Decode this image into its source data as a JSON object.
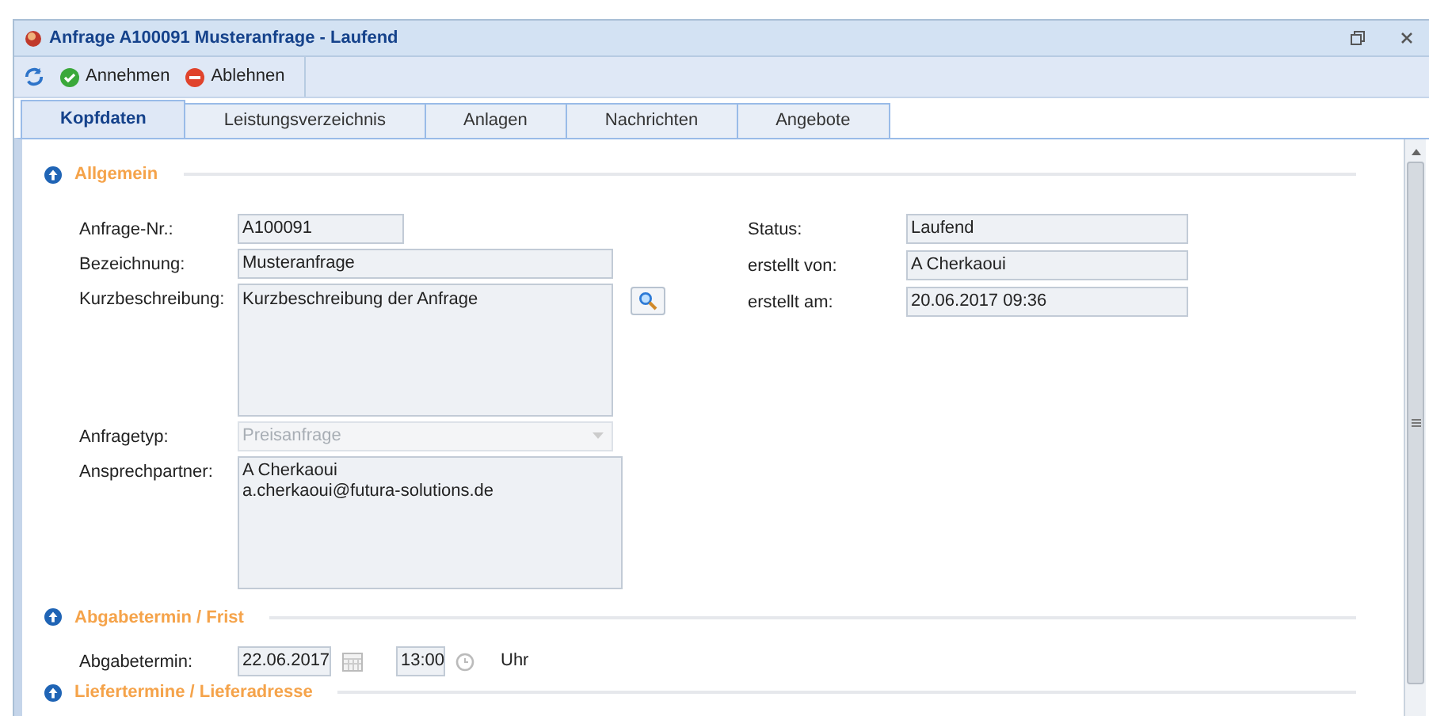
{
  "window": {
    "title": "Anfrage A100091 Musteranfrage - Laufend"
  },
  "toolbar": [
    {
      "label": "Annehmen",
      "kind": "accept"
    },
    {
      "label": "Ablehnen",
      "kind": "reject"
    }
  ],
  "tabs": [
    {
      "label": "Kopfdaten",
      "selected": true
    },
    {
      "label": "Leistungsverzeichnis",
      "selected": false
    },
    {
      "label": "Anlagen",
      "selected": false
    },
    {
      "label": "Nachrichten",
      "selected": false
    },
    {
      "label": "Angebote",
      "selected": false
    }
  ],
  "section_general": {
    "title": "Allgemein",
    "left_fields": [
      {
        "label": "Anfrage-Nr.:",
        "value": "A100091",
        "kind": "short"
      },
      {
        "label": "Bezeichnung:",
        "value": "Musteranfrage",
        "kind": "text"
      },
      {
        "label": "Kurzbeschreibung:",
        "value": "Kurzbeschreibung der Anfrage",
        "kind": "textarea"
      },
      {
        "label": "Anfragetyp:",
        "value": "Preisanfrage",
        "kind": "select",
        "disabled": true
      },
      {
        "label": "Ansprechpartner:",
        "value": "A Cherkaoui\na.cherkaoui@futura-solutions.de",
        "kind": "memo"
      }
    ],
    "right_fields": [
      {
        "label": "Status:",
        "value": "Laufend"
      },
      {
        "label": "erstellt von:",
        "value": "A Cherkaoui"
      },
      {
        "label": "erstellt am:",
        "value": "20.06.2017 09:36"
      }
    ]
  },
  "section_deadline": {
    "title": "Abgabetermin / Frist",
    "label": "Abgabetermin:",
    "date": "22.06.2017",
    "time": "13:00",
    "unit": "Uhr"
  },
  "section_delivery": {
    "title": "Liefertermine / Lieferadresse"
  }
}
